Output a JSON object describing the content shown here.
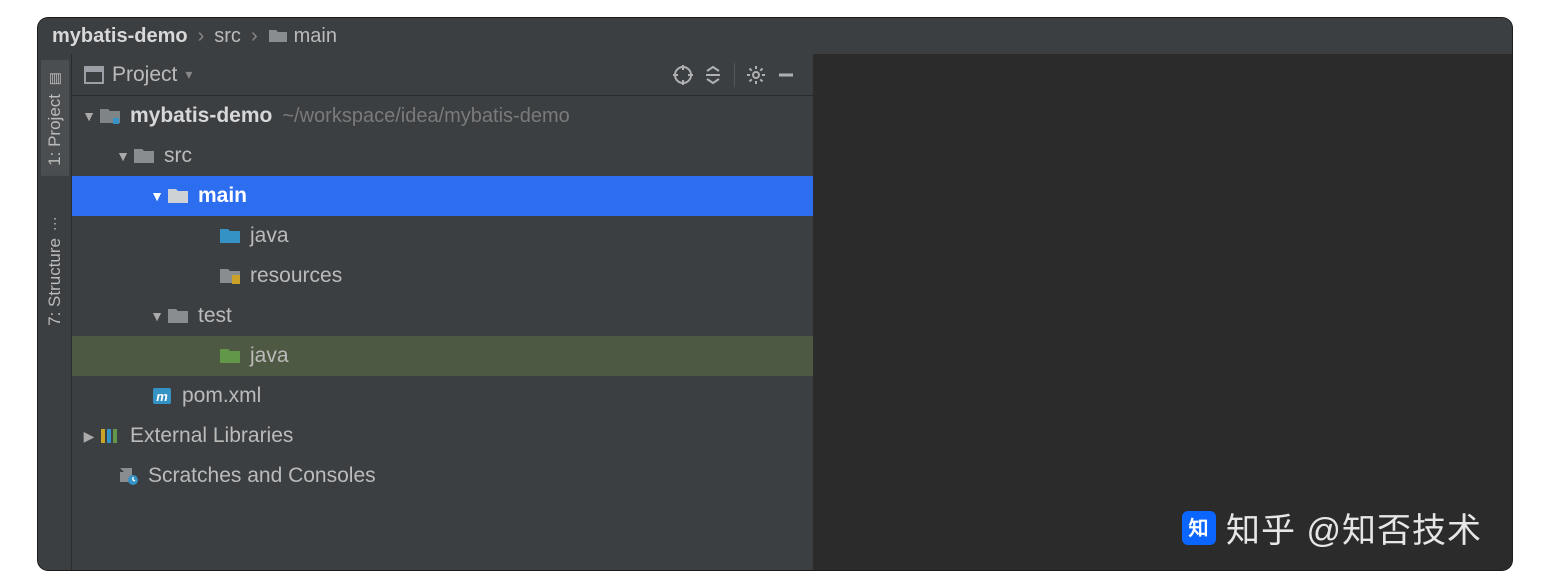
{
  "breadcrumb": {
    "root": "mybatis-demo",
    "src": "src",
    "main": "main"
  },
  "sidebar": {
    "project_tab": "1: Project",
    "structure_tab": "7: Structure"
  },
  "panel": {
    "title": "Project"
  },
  "tree": {
    "root": {
      "name": "mybatis-demo",
      "path": "~/workspace/idea/mybatis-demo"
    },
    "src": "src",
    "main": "main",
    "main_java": "java",
    "resources": "resources",
    "test": "test",
    "test_java": "java",
    "pom": "pom.xml",
    "ext": "External Libraries",
    "scratch": "Scratches and Consoles"
  },
  "watermark": "知乎 @知否技术"
}
